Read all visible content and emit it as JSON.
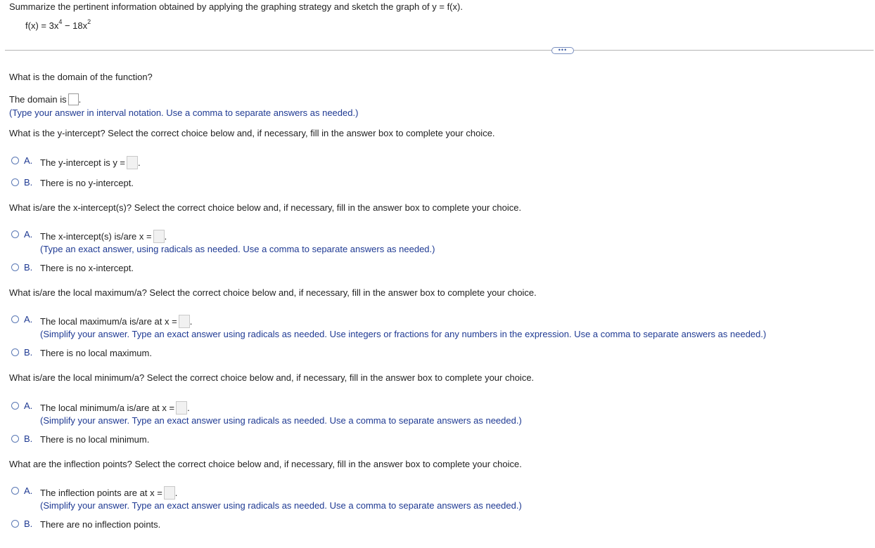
{
  "header": {
    "prompt": "Summarize the pertinent information obtained by applying the graphing strategy and sketch the graph of y = f(x).",
    "function_lhs": "f(x) = 3x",
    "exp1": "4",
    "function_mid": " − 18x",
    "exp2": "2"
  },
  "more_button": "•••",
  "domain": {
    "question": "What is the domain of the function?",
    "label": "The domain is",
    "hint": "(Type your answer in interval notation. Use a comma to separate answers as needed.)"
  },
  "y_intercept": {
    "question": "What is the y-intercept? Select the correct choice below and, if necessary, fill in the answer box to complete your choice.",
    "a_letter": "A.",
    "a_text": "The y-intercept is y =",
    "b_letter": "B.",
    "b_text": "There is no y-intercept."
  },
  "x_intercept": {
    "question": "What is/are the x-intercept(s)? Select the correct choice below and, if necessary, fill in the answer box to complete your choice.",
    "a_letter": "A.",
    "a_text": "The x-intercept(s) is/are x =",
    "a_hint": "(Type an exact answer, using radicals as needed. Use a comma to separate answers as needed.)",
    "b_letter": "B.",
    "b_text": "There is no x-intercept."
  },
  "local_max": {
    "question": "What is/are the local maximum/a? Select the correct choice below and, if necessary, fill in the answer box to complete your choice.",
    "a_letter": "A.",
    "a_text": "The local maximum/a is/are at x =",
    "a_hint": "(Simplify your answer. Type an exact answer using radicals as needed. Use integers or fractions for any numbers in the expression. Use a comma to separate answers as needed.)",
    "b_letter": "B.",
    "b_text": "There is no local maximum."
  },
  "local_min": {
    "question": "What is/are the local minimum/a? Select the correct choice below and, if necessary, fill in the answer box to complete your choice.",
    "a_letter": "A.",
    "a_text": "The local minimum/a is/are at x =",
    "a_hint": "(Simplify your answer. Type an exact answer using radicals as needed. Use a comma to separate answers as needed.)",
    "b_letter": "B.",
    "b_text": "There is no local minimum."
  },
  "inflection": {
    "question": "What are the inflection points? Select the correct choice below and, if necessary, fill in the answer box to complete your choice.",
    "a_letter": "A.",
    "a_text": "The inflection points are at x =",
    "a_hint": "(Simplify your answer. Type an exact answer using radicals as needed. Use a comma to separate answers as needed.)",
    "b_letter": "B.",
    "b_text": "There are no inflection points."
  }
}
